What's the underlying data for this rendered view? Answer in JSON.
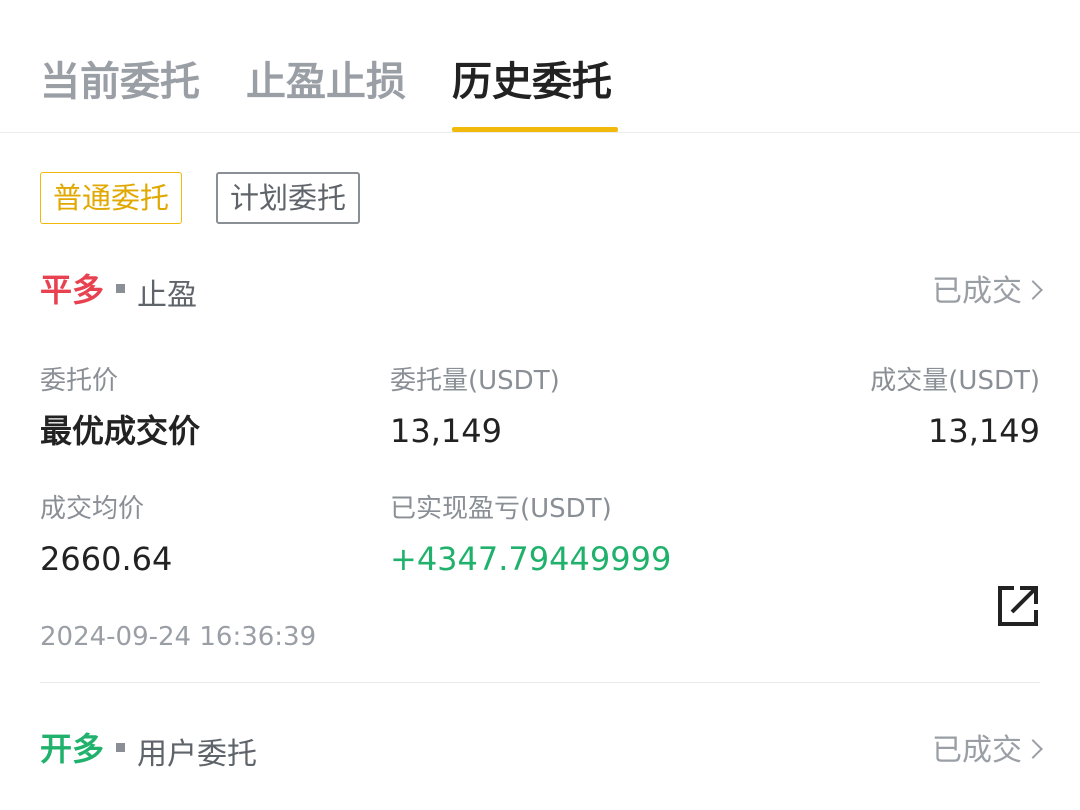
{
  "tabs": [
    {
      "label": "当前委托",
      "active": false
    },
    {
      "label": "止盈止损",
      "active": false
    },
    {
      "label": "历史委托",
      "active": true
    }
  ],
  "filters": [
    {
      "label": "普通委托",
      "active": true
    },
    {
      "label": "计划委托",
      "active": false
    }
  ],
  "orders": [
    {
      "side": "平多",
      "type": "止盈",
      "status": "已成交",
      "fields": {
        "order_price_label": "委托价",
        "order_price": "最优成交价",
        "order_qty_label": "委托量(USDT)",
        "order_qty": "13,149",
        "filled_qty_label": "成交量(USDT)",
        "filled_qty": "13,149",
        "avg_price_label": "成交均价",
        "avg_price": "2660.64",
        "pnl_label": "已实现盈亏(USDT)",
        "pnl": "+4347.79449999"
      },
      "time": "2024-09-24 16:36:39"
    },
    {
      "side": "开多",
      "type": "用户委托",
      "status": "已成交"
    }
  ],
  "colors": {
    "accent": "#f0b90b",
    "short": "#e8414f",
    "long": "#20b26c"
  },
  "icons": [
    "chevron-right-icon",
    "share-icon"
  ]
}
